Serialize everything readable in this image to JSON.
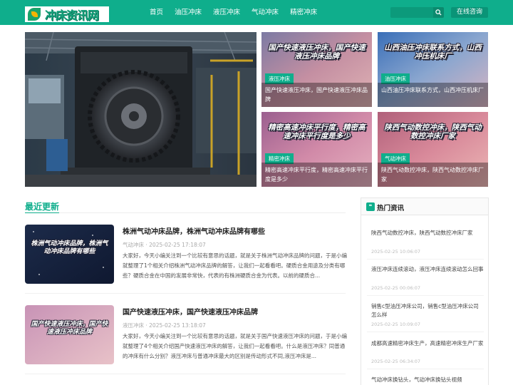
{
  "header": {
    "logo_text": "冲床资讯网",
    "nav": [
      "首页",
      "油压冲床",
      "液压冲床",
      "气动冲床",
      "精密冲床"
    ],
    "consult_label": "在线咨询",
    "search_placeholder": ""
  },
  "tiles": [
    {
      "headline": "国产快速液压冲床，国产快速液压冲床品牌",
      "tag": "液压冲床",
      "caption": "国产快速液压冲床，国产快速液压冲床品牌"
    },
    {
      "headline": "山西油压冲床联系方式，山西冲压机床厂",
      "tag": "油压冲床",
      "caption": "山西油压冲床联系方式，山西冲压机床厂"
    },
    {
      "headline": "精密高速冲床平行度，精密高速冲床平行度是多少",
      "tag": "精密冲床",
      "caption": "精密高速冲床平行度，精密高速冲床平行度是多少"
    },
    {
      "headline": "陕西气动数控冲床，陕西气动数控冲床厂家",
      "tag": "气动冲床",
      "caption": "陕西气动数控冲床，陕西气动数控冲床厂家"
    }
  ],
  "recent": {
    "title": "最近更新",
    "articles": [
      {
        "image_text": "株洲气动冲床品牌，株洲气动冲床品牌有哪些",
        "title": "株洲气动冲床品牌，株洲气动冲床品牌有哪些",
        "meta": "气动冲床 · 2025-02-25 17:18:07",
        "body": "大家好，今天小编关注到一个比较有意思的话题，就是关于株洲气动冲床品牌的问题，于是小编就整理了1个相关介绍株洲气动冲床品牌的解答，让我们一起看看吧。硬质合金用途及分类有哪些？硬质合金在中国的发展非常快，代表的有株洲硬质合金为代表。以前的硬质合..."
      },
      {
        "image_text": "国产快速液压冲床，国产快速液压冲床品牌",
        "title": "国产快速液压冲床，国产快速液压冲床品牌",
        "meta": "液压冲床 · 2025-02-25 13:18:07",
        "body": "大家好，今天小编关注到一个比较有意思的话题，就是关于国产快速液压冲床的问题，于是小编就整理了4个相关介绍国产快速液压冲床的解答，让我们一起看看吧。什么是液压冲床？同普通的冲床有什么分别？液压冲床与普通冲床最大的区别是传动形式不同,液压冲床是..."
      }
    ]
  },
  "hot": {
    "title": "热门资讯",
    "items": [
      {
        "title": "陕西气动数控冲床，陕西气动数控冲床厂家",
        "date": "2025-02-25 10:06:07"
      },
      {
        "title": "液压冲床连续滚动，液压冲床连续滚动怎么回事",
        "date": "2025-02-25 00:06:07"
      },
      {
        "title": "销售c型油压冲床公司，销售c型油压冲床公司怎么样",
        "date": "2025-02-25 10:09:07"
      },
      {
        "title": "成都高速精密冲床生产，高速精密冲床生产厂家",
        "date": "2025-02-25 06:34:07"
      },
      {
        "title": "气动冲床换钻头，气动冲床换钻头视频",
        "date": ""
      }
    ]
  },
  "colors": {
    "brand": "#0fae8c"
  }
}
